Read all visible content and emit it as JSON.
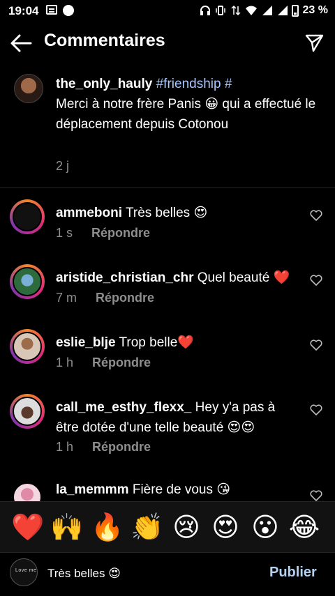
{
  "status": {
    "time": "19:04",
    "battery": "23 %"
  },
  "header": {
    "title": "Commentaires"
  },
  "caption": {
    "username": "the_only_hauly",
    "hashtag": "#friendship",
    "hash_suffix": " #",
    "text": "Merci à notre frère Panis",
    "emoji": "😀",
    "text2": "qui a effectué le déplacement depuis Cotonou",
    "time": "2 j"
  },
  "reply_label": "Répondre",
  "comments": [
    {
      "username": "ammeboni",
      "text": "Très belles",
      "emoji": "😍",
      "time": "1 s"
    },
    {
      "username": "aristide_christian_chr",
      "text": "Quel beauté",
      "emoji": "❤️",
      "time": "7 m"
    },
    {
      "username": "eslie_blje",
      "text": "Trop belle",
      "emoji": "❤️",
      "time": "1 h"
    },
    {
      "username": "call_me_esthy_flexx_",
      "text": "Hey y'a pas à être dotée d'une telle beauté",
      "emoji": "😍😍",
      "time": "1 h"
    },
    {
      "username": "la_memmm",
      "text": "Fière de vous",
      "emoji": "😘",
      "time": ""
    }
  ],
  "emoji_bar": [
    "❤️",
    "🙌",
    "🔥",
    "👏",
    "😢",
    "😍",
    "😮",
    "😂"
  ],
  "input": {
    "avatar_text": "Love me",
    "value": "Très belles 😍",
    "publish_label": "Publier"
  },
  "colors": {
    "background": "#000000",
    "muted": "#8e8e8e",
    "hashtag": "#a6c8ff",
    "publish": "#b3d1f5"
  }
}
